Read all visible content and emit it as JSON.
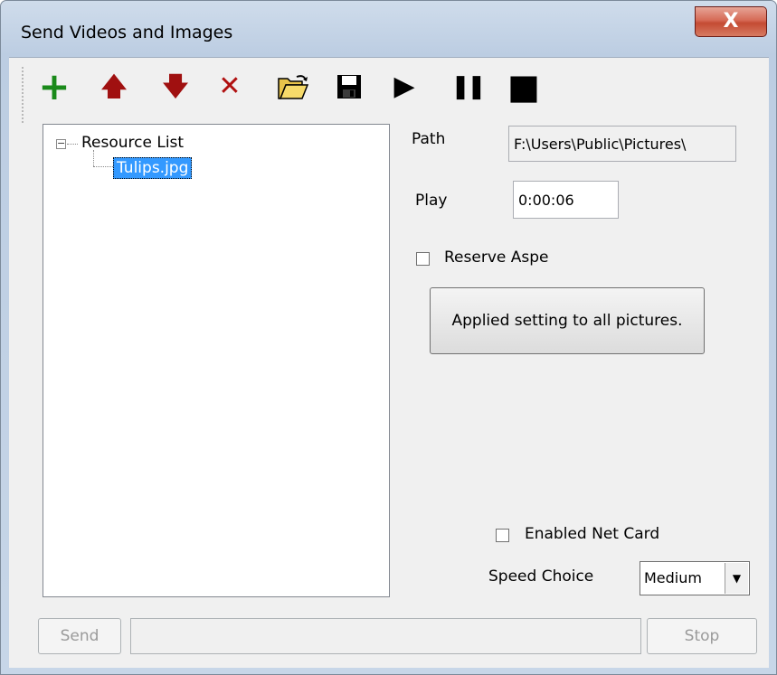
{
  "window": {
    "title": "Send Videos and Images",
    "close_glyph": "X"
  },
  "toolbar": {
    "items": [
      {
        "name": "add-icon",
        "glyph": "+"
      },
      {
        "name": "move-up-icon",
        "glyph": "🡅"
      },
      {
        "name": "move-down-icon",
        "glyph": "🡇"
      },
      {
        "name": "delete-icon",
        "glyph": "✕"
      },
      {
        "name": "open-folder-icon",
        "glyph": "open-folder"
      },
      {
        "name": "save-icon",
        "glyph": "floppy-disk"
      },
      {
        "name": "play-icon",
        "glyph": "▶"
      },
      {
        "name": "pause-icon",
        "glyph": "❚❚"
      },
      {
        "name": "stop-icon",
        "glyph": "■"
      }
    ]
  },
  "tree": {
    "expander": "−",
    "root_label": "Resource List",
    "items": [
      {
        "label": "Tulips.jpg",
        "selected": true
      }
    ]
  },
  "path": {
    "label": "Path",
    "value": "F:\\Users\\Public\\Pictures\\"
  },
  "play": {
    "label": "Play",
    "value": "0:00:06"
  },
  "reserve_aspect": {
    "label": "Reserve Aspe",
    "checked": false
  },
  "apply_button": {
    "label": "Applied setting to all pictures."
  },
  "net_card": {
    "label": "Enabled Net Card",
    "checked": false
  },
  "speed": {
    "label": "Speed Choice",
    "value": "Medium",
    "arrow": "▼"
  },
  "bottom": {
    "send_label": "Send",
    "stop_label": "Stop",
    "progress": 0
  },
  "colors": {
    "selection": "#3399ff",
    "add": "#1a8a1a",
    "arrows": "#a01010"
  }
}
